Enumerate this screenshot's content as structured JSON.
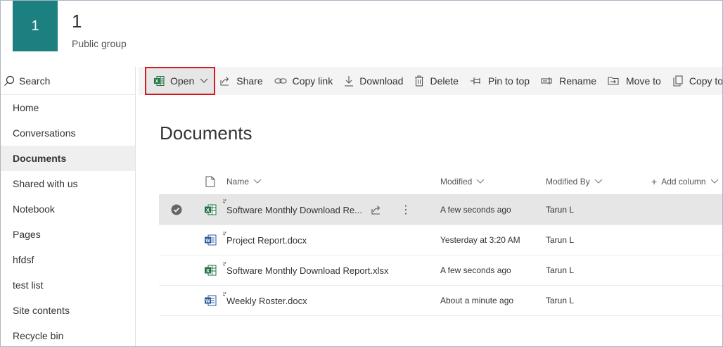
{
  "site": {
    "tile_letter": "1",
    "title": "1",
    "subtitle": "Public group",
    "tile_color": "#1d8080"
  },
  "leftnav": {
    "search_label": "Search",
    "items": [
      {
        "label": "Home"
      },
      {
        "label": "Conversations"
      },
      {
        "label": "Documents",
        "active": true
      },
      {
        "label": "Shared with us"
      },
      {
        "label": "Notebook"
      },
      {
        "label": "Pages"
      },
      {
        "label": "hfdsf"
      },
      {
        "label": "test list"
      },
      {
        "label": "Site contents"
      },
      {
        "label": "Recycle bin"
      }
    ]
  },
  "commandbar": {
    "open": "Open",
    "share": "Share",
    "copy_link": "Copy link",
    "download": "Download",
    "delete": "Delete",
    "pin_to_top": "Pin to top",
    "rename": "Rename",
    "move_to": "Move to",
    "copy_to": "Copy to",
    "highlight_color": "#d11b1f"
  },
  "main": {
    "title": "Documents",
    "columns": {
      "name": "Name",
      "modified": "Modified",
      "modified_by": "Modified By",
      "add_column": "Add column"
    },
    "rows": [
      {
        "type": "xlsx",
        "name": "Software Monthly Download Re...",
        "modified": "A few seconds ago",
        "modified_by": "Tarun L",
        "selected": true
      },
      {
        "type": "docx",
        "name": "Project Report.docx",
        "modified": "Yesterday at 3:20 AM",
        "modified_by": "Tarun L"
      },
      {
        "type": "xlsx",
        "name": "Software Monthly Download Report.xlsx",
        "modified": "A few seconds ago",
        "modified_by": "Tarun L"
      },
      {
        "type": "docx",
        "name": "Weekly Roster.docx",
        "modified": "About a minute ago",
        "modified_by": "Tarun L"
      }
    ]
  }
}
